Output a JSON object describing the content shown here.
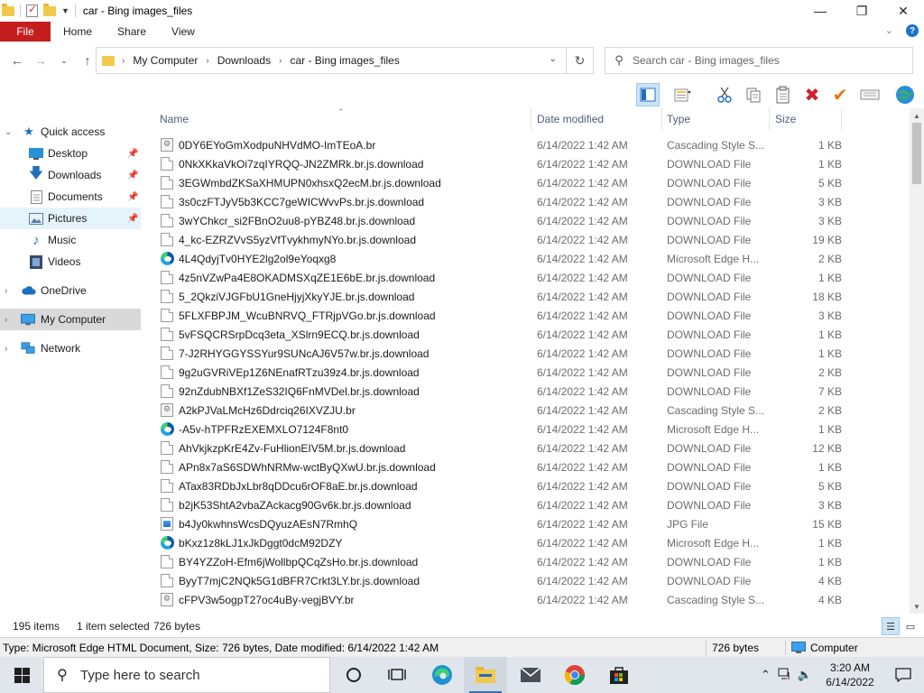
{
  "window": {
    "title": "car - Bing images_files",
    "controls": [
      "—",
      "☐",
      "✕"
    ]
  },
  "ribbon": {
    "file": "File",
    "tabs": [
      "Home",
      "Share",
      "View"
    ]
  },
  "address": {
    "crumbs": [
      "My Computer",
      "Downloads",
      "car - Bing images_files"
    ]
  },
  "search": {
    "placeholder": "Search car - Bing images_files"
  },
  "sidebar": {
    "quick_access": "Quick access",
    "items": [
      "Desktop",
      "Downloads",
      "Documents",
      "Pictures",
      "Music",
      "Videos"
    ],
    "onedrive": "OneDrive",
    "my_computer": "My Computer",
    "network": "Network"
  },
  "columns": {
    "name": "Name",
    "date": "Date modified",
    "type": "Type",
    "size": "Size"
  },
  "files": [
    {
      "name": "0DY6EYoGmXodpuNHVdMO-ImTEoA.br",
      "date": "6/14/2022 1:42 AM",
      "type": "Cascading Style S...",
      "size": "1 KB",
      "icon": "css"
    },
    {
      "name": "0NkXKkaVkOi7zqIYRQQ-JN2ZMRk.br.js.download",
      "date": "6/14/2022 1:42 AM",
      "type": "DOWNLOAD File",
      "size": "1 KB",
      "icon": "doc"
    },
    {
      "name": "3EGWmbdZKSaXHMUPN0xhsxQ2ecM.br.js.download",
      "date": "6/14/2022 1:42 AM",
      "type": "DOWNLOAD File",
      "size": "5 KB",
      "icon": "doc"
    },
    {
      "name": "3s0czFTJyV5b3KCC7geWICWvvPs.br.js.download",
      "date": "6/14/2022 1:42 AM",
      "type": "DOWNLOAD File",
      "size": "3 KB",
      "icon": "doc"
    },
    {
      "name": "3wYChkcr_si2FBnO2uu8-pYBZ48.br.js.download",
      "date": "6/14/2022 1:42 AM",
      "type": "DOWNLOAD File",
      "size": "3 KB",
      "icon": "doc"
    },
    {
      "name": "4_kc-EZRZVvS5yzVfTvykhmyNYo.br.js.download",
      "date": "6/14/2022 1:42 AM",
      "type": "DOWNLOAD File",
      "size": "19 KB",
      "icon": "doc"
    },
    {
      "name": "4L4QdyjTv0HYE2lg2ol9eYoqxg8",
      "date": "6/14/2022 1:42 AM",
      "type": "Microsoft Edge H...",
      "size": "2 KB",
      "icon": "edge"
    },
    {
      "name": "4z5nVZwPa4E8OKADMSXqZE1E6bE.br.js.download",
      "date": "6/14/2022 1:42 AM",
      "type": "DOWNLOAD File",
      "size": "1 KB",
      "icon": "doc"
    },
    {
      "name": "5_2QkziVJGFbU1GneHjyjXkyYJE.br.js.download",
      "date": "6/14/2022 1:42 AM",
      "type": "DOWNLOAD File",
      "size": "18 KB",
      "icon": "doc"
    },
    {
      "name": "5FLXFBPJM_WcuBNRVQ_FTRjpVGo.br.js.download",
      "date": "6/14/2022 1:42 AM",
      "type": "DOWNLOAD File",
      "size": "3 KB",
      "icon": "doc"
    },
    {
      "name": "5vFSQCRSrpDcq3eta_XSlrn9ECQ.br.js.download",
      "date": "6/14/2022 1:42 AM",
      "type": "DOWNLOAD File",
      "size": "1 KB",
      "icon": "doc"
    },
    {
      "name": "7-J2RHYGGYSSYur9SUNcAJ6V57w.br.js.download",
      "date": "6/14/2022 1:42 AM",
      "type": "DOWNLOAD File",
      "size": "1 KB",
      "icon": "doc"
    },
    {
      "name": "9g2uGVRiVEp1Z6NEnafRTzu39z4.br.js.download",
      "date": "6/14/2022 1:42 AM",
      "type": "DOWNLOAD File",
      "size": "2 KB",
      "icon": "doc"
    },
    {
      "name": "92nZdubNBXf1ZeS32IQ6FnMVDel.br.js.download",
      "date": "6/14/2022 1:42 AM",
      "type": "DOWNLOAD File",
      "size": "7 KB",
      "icon": "doc"
    },
    {
      "name": "A2kPJVaLMcHz6Ddrciq26IXVZJU.br",
      "date": "6/14/2022 1:42 AM",
      "type": "Cascading Style S...",
      "size": "2 KB",
      "icon": "css"
    },
    {
      "name": "-A5v-hTPFRzEXEMXLO7124F8nt0",
      "date": "6/14/2022 1:42 AM",
      "type": "Microsoft Edge H...",
      "size": "1 KB",
      "icon": "edge"
    },
    {
      "name": "AhVkjkzpKrE4Zv-FuHlionEIV5M.br.js.download",
      "date": "6/14/2022 1:42 AM",
      "type": "DOWNLOAD File",
      "size": "12 KB",
      "icon": "doc"
    },
    {
      "name": "APn8x7aS6SDWhNRMw-wctByQXwU.br.js.download",
      "date": "6/14/2022 1:42 AM",
      "type": "DOWNLOAD File",
      "size": "1 KB",
      "icon": "doc"
    },
    {
      "name": "ATax83RDbJxLbr8qDDcu6rOF8aE.br.js.download",
      "date": "6/14/2022 1:42 AM",
      "type": "DOWNLOAD File",
      "size": "5 KB",
      "icon": "doc"
    },
    {
      "name": "b2jK53ShtA2vbaZAckacg90Gv6k.br.js.download",
      "date": "6/14/2022 1:42 AM",
      "type": "DOWNLOAD File",
      "size": "3 KB",
      "icon": "doc"
    },
    {
      "name": "b4Jy0kwhnsWcsDQyuzAEsN7RmhQ",
      "date": "6/14/2022 1:42 AM",
      "type": "JPG File",
      "size": "15 KB",
      "icon": "jpg"
    },
    {
      "name": "bKxz1z8kLJ1xJkDggt0dcM92DZY",
      "date": "6/14/2022 1:42 AM",
      "type": "Microsoft Edge H...",
      "size": "1 KB",
      "icon": "edge"
    },
    {
      "name": "BY4YZZoH-Efm6jWollbpQCqZsHo.br.js.download",
      "date": "6/14/2022 1:42 AM",
      "type": "DOWNLOAD File",
      "size": "1 KB",
      "icon": "doc"
    },
    {
      "name": "ByyT7mjC2NQk5G1dBFR7Crkt3LY.br.js.download",
      "date": "6/14/2022 1:42 AM",
      "type": "DOWNLOAD File",
      "size": "4 KB",
      "icon": "doc"
    },
    {
      "name": "cFPV3w5ogpT27oc4uBy-vegjBVY.br",
      "date": "6/14/2022 1:42 AM",
      "type": "Cascading Style S...",
      "size": "4 KB",
      "icon": "css"
    }
  ],
  "status": {
    "items": "195 items",
    "selected": "1 item selected",
    "selected_size": "726 bytes"
  },
  "infobar": {
    "details": "Type: Microsoft Edge HTML Document, Size: 726 bytes, Date modified: 6/14/2022 1:42 AM",
    "size": "726 bytes",
    "location": "Computer"
  },
  "taskbar": {
    "search_placeholder": "Type here to search",
    "time": "3:20 AM",
    "date": "6/14/2022"
  }
}
